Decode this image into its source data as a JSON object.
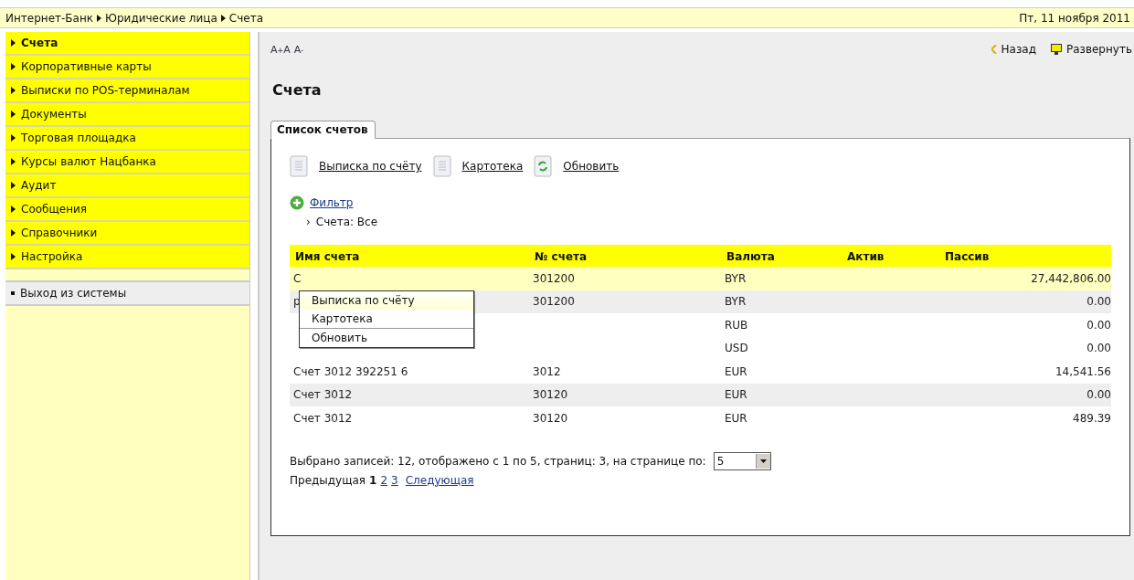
{
  "breadcrumb": [
    "Интернет-Банк",
    "Юридические лица",
    "Счета"
  ],
  "date": "Пт, 11 ноября 2011",
  "sidebar": {
    "items": [
      {
        "label": "Счета",
        "selected": true
      },
      {
        "label": "Корпоративные карты",
        "selected": false
      },
      {
        "label": "Выписки по POS-терминалам",
        "selected": false
      },
      {
        "label": "Документы",
        "selected": false
      },
      {
        "label": "Торговая площадка",
        "selected": false
      },
      {
        "label": "Курсы валют Нацбанка",
        "selected": false
      },
      {
        "label": "Аудит",
        "selected": false
      },
      {
        "label": "Сообщения",
        "selected": false
      },
      {
        "label": "Справочники",
        "selected": false
      },
      {
        "label": "Настройка",
        "selected": false
      }
    ],
    "logout": "Выход из системы"
  },
  "font_controls": [
    "A",
    "+",
    "A",
    "A",
    "-"
  ],
  "nav": {
    "back": "Назад",
    "expand": "Развернуть"
  },
  "title": "Счета",
  "tabs": [
    {
      "label": "Список счетов",
      "selected": true
    }
  ],
  "toolbar": [
    {
      "label": "Выписка по счёту",
      "kind": "document"
    },
    {
      "label": "Картотека",
      "kind": "document"
    },
    {
      "label": "Обновить",
      "kind": "refresh"
    }
  ],
  "filter": {
    "label": "Фильтр",
    "marker": "›",
    "value": "Счета: Все"
  },
  "table": {
    "columns": [
      "Имя счета",
      "№ счета",
      "Валюта",
      "Актив",
      "Пассив"
    ],
    "rows": [
      {
        "name": "С",
        "number": "301200",
        "selected": true,
        "lines": [
          {
            "currency": "BYR",
            "passive": "27,442,806.00"
          }
        ]
      },
      {
        "name": "р",
        "number": "301200",
        "selected": false,
        "lines": [
          {
            "currency": "BYR",
            "passive": "0.00"
          }
        ]
      },
      {
        "name": "Счет 3012 392251 6",
        "number": "3012",
        "selected": false,
        "lines": [
          {
            "currency": "RUB",
            "passive": "0.00"
          },
          {
            "currency": "USD",
            "passive": "0.00"
          },
          {
            "currency": "EUR",
            "passive": "14,541.56"
          }
        ]
      },
      {
        "name": "Счет 3012",
        "number": "30120",
        "selected": false,
        "lines": [
          {
            "currency": "EUR",
            "passive": "0.00"
          }
        ]
      },
      {
        "name": "Счет 3012",
        "number": "30120",
        "selected": false,
        "lines": [
          {
            "currency": "EUR",
            "passive": "489.39"
          }
        ]
      }
    ]
  },
  "context_menu": [
    {
      "label": "Выписка по счёту",
      "selected": true
    },
    {
      "label": "Картотека",
      "selected": false
    },
    {
      "label": "Обновить",
      "selected": false
    }
  ],
  "summary": "Выбрано записей: 12, отображено с 1 по 5, страниц: 3, на странице по:",
  "page_size": "5",
  "pagination": {
    "previous": "Предыдущая",
    "pages": [
      {
        "label": "1",
        "selected": true
      },
      {
        "label": "2",
        "selected": false
      },
      {
        "label": "3",
        "selected": false
      }
    ],
    "next": "Следующая"
  }
}
